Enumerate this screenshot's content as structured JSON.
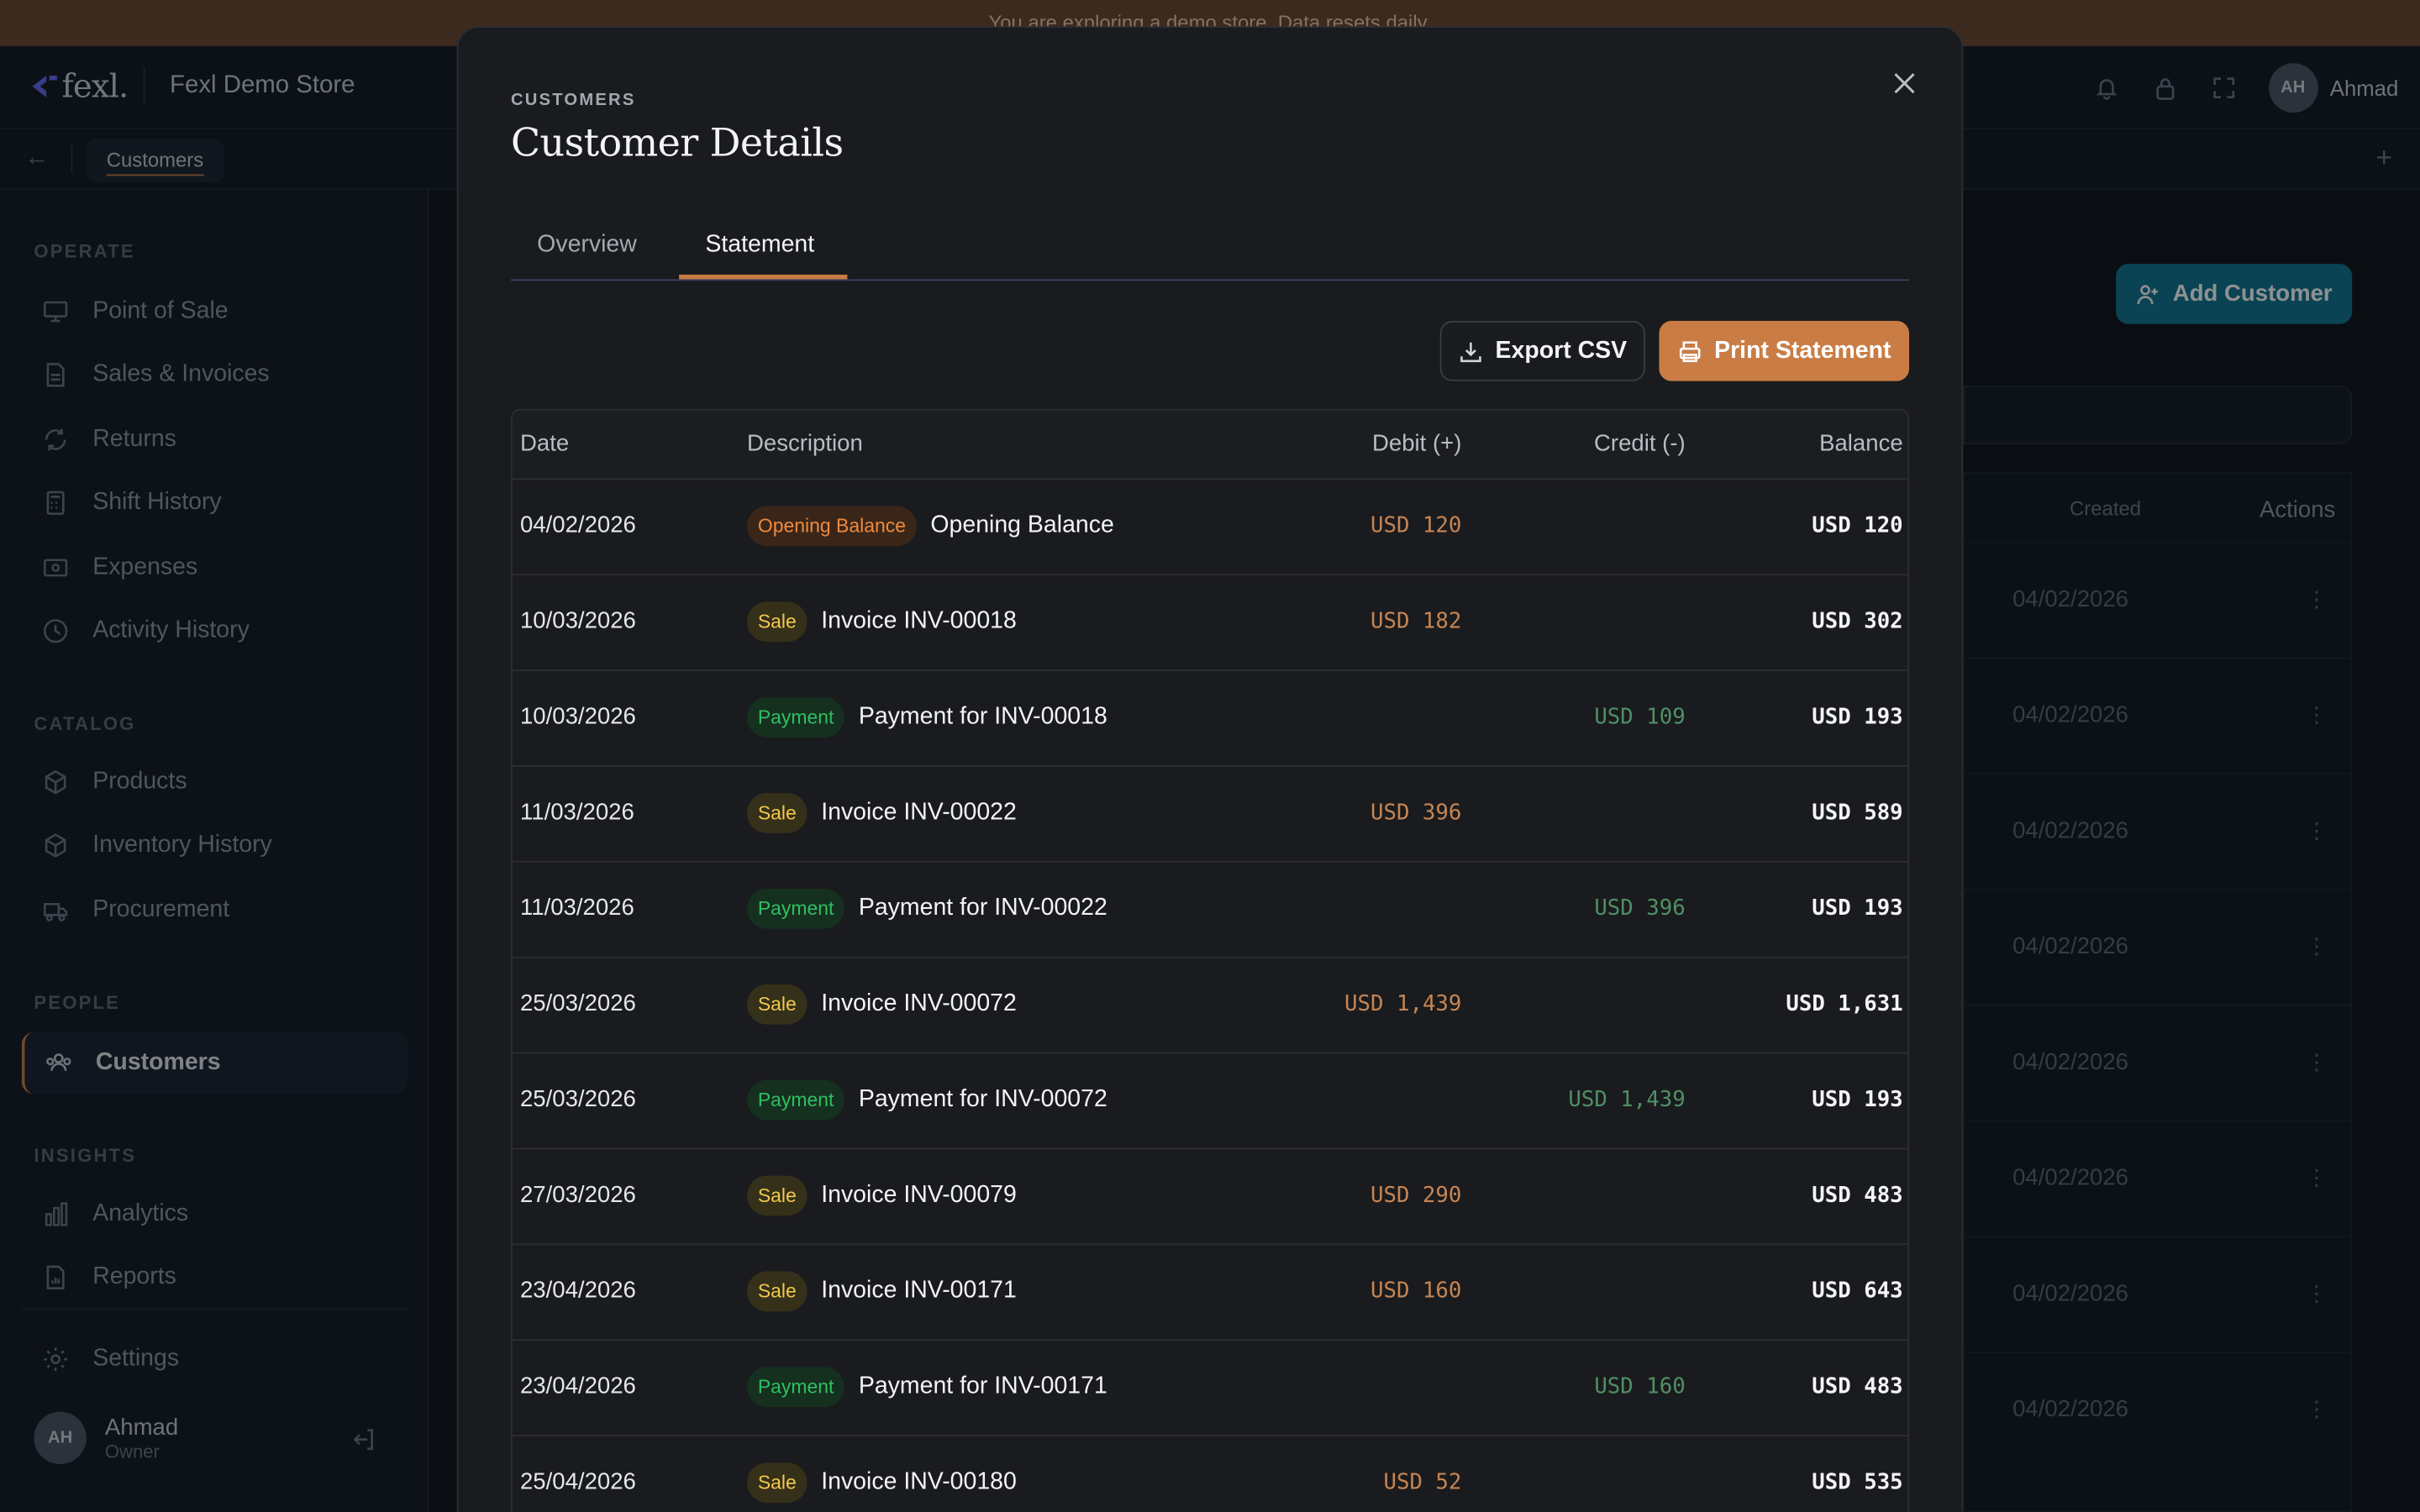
{
  "banner": {
    "text": "You are exploring a demo store. Data resets daily."
  },
  "topbar": {
    "logo_text": "fexl.",
    "store_name": "Fexl Demo Store",
    "user_initials": "AH",
    "user_name": "Ahmad"
  },
  "tabbar": {
    "active_tab": "Customers"
  },
  "sidebar": {
    "sections": [
      {
        "title": "OPERATE",
        "items": [
          "Point of Sale",
          "Sales & Invoices",
          "Returns",
          "Shift History",
          "Expenses",
          "Activity History"
        ]
      },
      {
        "title": "CATALOG",
        "items": [
          "Products",
          "Inventory History",
          "Procurement"
        ]
      },
      {
        "title": "PEOPLE",
        "items": [
          "Customers"
        ]
      },
      {
        "title": "INSIGHTS",
        "items": [
          "Analytics",
          "Reports"
        ]
      }
    ],
    "settings_label": "Settings",
    "user": {
      "initials": "AH",
      "name": "Ahmad",
      "role": "Owner"
    },
    "active_item": "Customers"
  },
  "background": {
    "add_button": "Add Customer",
    "columns": {
      "created": "Created",
      "actions": "Actions"
    },
    "rows": [
      "04/02/2026",
      "04/02/2026",
      "04/02/2026",
      "04/02/2026",
      "04/02/2026",
      "04/02/2026",
      "04/02/2026",
      "04/02/2026"
    ]
  },
  "modal": {
    "eyebrow": "CUSTOMERS",
    "title": "Customer Details",
    "tabs": [
      "Overview",
      "Statement"
    ],
    "active_tab": "Statement",
    "export_label": "Export CSV",
    "print_label": "Print Statement",
    "columns": {
      "date": "Date",
      "description": "Description",
      "debit": "Debit (+)",
      "credit": "Credit (-)",
      "balance": "Balance"
    },
    "rows": [
      {
        "date": "04/02/2026",
        "badge": "Opening Balance",
        "type": "opening",
        "desc": "Opening Balance",
        "debit": "USD 120",
        "credit": "",
        "balance": "USD 120"
      },
      {
        "date": "10/03/2026",
        "badge": "Sale",
        "type": "sale",
        "desc": "Invoice INV-00018",
        "debit": "USD 182",
        "credit": "",
        "balance": "USD 302"
      },
      {
        "date": "10/03/2026",
        "badge": "Payment",
        "type": "payment",
        "desc": "Payment for INV-00018",
        "debit": "",
        "credit": "USD 109",
        "balance": "USD 193"
      },
      {
        "date": "11/03/2026",
        "badge": "Sale",
        "type": "sale",
        "desc": "Invoice INV-00022",
        "debit": "USD 396",
        "credit": "",
        "balance": "USD 589"
      },
      {
        "date": "11/03/2026",
        "badge": "Payment",
        "type": "payment",
        "desc": "Payment for INV-00022",
        "debit": "",
        "credit": "USD 396",
        "balance": "USD 193"
      },
      {
        "date": "25/03/2026",
        "badge": "Sale",
        "type": "sale",
        "desc": "Invoice INV-00072",
        "debit": "USD 1,439",
        "credit": "",
        "balance": "USD 1,631"
      },
      {
        "date": "25/03/2026",
        "badge": "Payment",
        "type": "payment",
        "desc": "Payment for INV-00072",
        "debit": "",
        "credit": "USD 1,439",
        "balance": "USD 193"
      },
      {
        "date": "27/03/2026",
        "badge": "Sale",
        "type": "sale",
        "desc": "Invoice INV-00079",
        "debit": "USD 290",
        "credit": "",
        "balance": "USD 483"
      },
      {
        "date": "23/04/2026",
        "badge": "Sale",
        "type": "sale",
        "desc": "Invoice INV-00171",
        "debit": "USD 160",
        "credit": "",
        "balance": "USD 643"
      },
      {
        "date": "23/04/2026",
        "badge": "Payment",
        "type": "payment",
        "desc": "Payment for INV-00171",
        "debit": "",
        "credit": "USD 160",
        "balance": "USD 483"
      },
      {
        "date": "25/04/2026",
        "badge": "Sale",
        "type": "sale",
        "desc": "Invoice INV-00180",
        "debit": "USD 52",
        "credit": "",
        "balance": "USD 535"
      }
    ]
  },
  "colors": {
    "accent": "#c97d45",
    "teal": "#0e7490",
    "indigo": "#6366f1"
  }
}
